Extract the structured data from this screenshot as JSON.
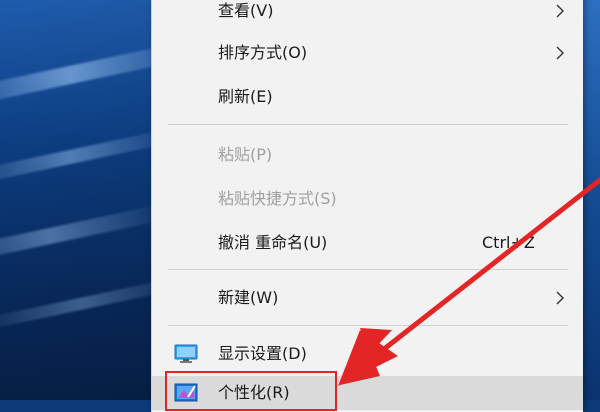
{
  "context_menu": {
    "items": [
      {
        "label": "查看(V)",
        "has_submenu": true,
        "enabled": true
      },
      {
        "label": "排序方式(O)",
        "has_submenu": true,
        "enabled": true
      },
      {
        "label": "刷新(E)",
        "has_submenu": false,
        "enabled": true
      },
      {
        "label": "粘贴(P)",
        "has_submenu": false,
        "enabled": false
      },
      {
        "label": "粘贴快捷方式(S)",
        "has_submenu": false,
        "enabled": false
      },
      {
        "label": "撤消 重命名(U)",
        "shortcut": "Ctrl+Z",
        "has_submenu": false,
        "enabled": true
      },
      {
        "label": "新建(W)",
        "has_submenu": true,
        "enabled": true
      },
      {
        "label": "显示设置(D)",
        "icon": "display-settings-icon",
        "has_submenu": false,
        "enabled": true
      },
      {
        "label": "个性化(R)",
        "icon": "personalize-icon",
        "has_submenu": false,
        "enabled": true,
        "highlighted": true
      }
    ]
  },
  "annotation": {
    "color": "#e32525",
    "target": "个性化(R)"
  },
  "colors": {
    "menu_background": "#f2f2f2",
    "disabled_text": "#a0a0a0",
    "hover_background": "#dadada",
    "desktop_blue": "#0f4590"
  }
}
